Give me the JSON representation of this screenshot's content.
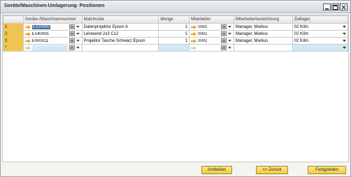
{
  "window": {
    "title": "Geräte/Maschinen-Umlagerung- Positionen"
  },
  "grid": {
    "headers": [
      "",
      "Geräte-/Maschinennummer",
      "Matchcode",
      "Menge",
      "Mitarbeiter",
      "Mitarbeiterbezeichnung",
      "Ziellager"
    ],
    "rows": [
      {
        "num": "1",
        "code": "E120000",
        "matchcode": "Datenprojektor Epson A",
        "menge": "1",
        "mitarbeiter": "0001",
        "bezeichnung": "Manager, Markus",
        "ziellager": "02 Köln"
      },
      {
        "num": "2",
        "code": "E140005",
        "matchcode": "Leinwand 2x3 C12",
        "menge": "1",
        "mitarbeiter": "0001",
        "bezeichnung": "Manager, Markus",
        "ziellager": "02 Köln"
      },
      {
        "num": "3",
        "code": "E000011",
        "matchcode": "Projektor Tasche Schwarz Epson",
        "menge": "1",
        "mitarbeiter": "0001",
        "bezeichnung": "Manager, Markus",
        "ziellager": "02 Köln"
      }
    ],
    "new_row_marker": "*"
  },
  "buttons": {
    "close": "Schließen",
    "back": "<< Zurück",
    "finish": "Fertigstellen"
  },
  "colors": {
    "row_header": "#f3c445",
    "button": "#f2cc3a",
    "arrow": "#e8a317"
  }
}
